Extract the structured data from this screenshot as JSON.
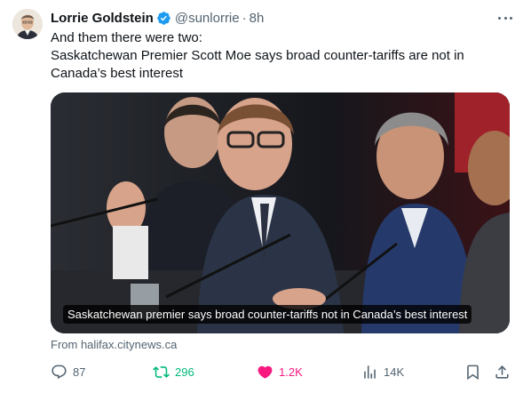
{
  "author": {
    "name": "Lorrie Goldstein",
    "handle": "@sunlorrie",
    "separator": "·",
    "time": "8h",
    "verified_icon": "verified-badge-icon",
    "verified_color": "#1d9bf0"
  },
  "tweet": {
    "lines": [
      "And them there were two:",
      "Saskatchewan Premier Scott Moe says broad counter-tariffs are not in",
      "Canada’s best interest"
    ]
  },
  "card": {
    "caption": "Saskatchewan premier says broad counter-tariffs not in Canada’s best interest",
    "source": "From halifax.citynews.ca"
  },
  "actions": {
    "replies": "87",
    "reposts": "296",
    "likes": "1.2K",
    "views": "14K",
    "repost_color": "#00ba7c",
    "like_color": "#f91880"
  }
}
